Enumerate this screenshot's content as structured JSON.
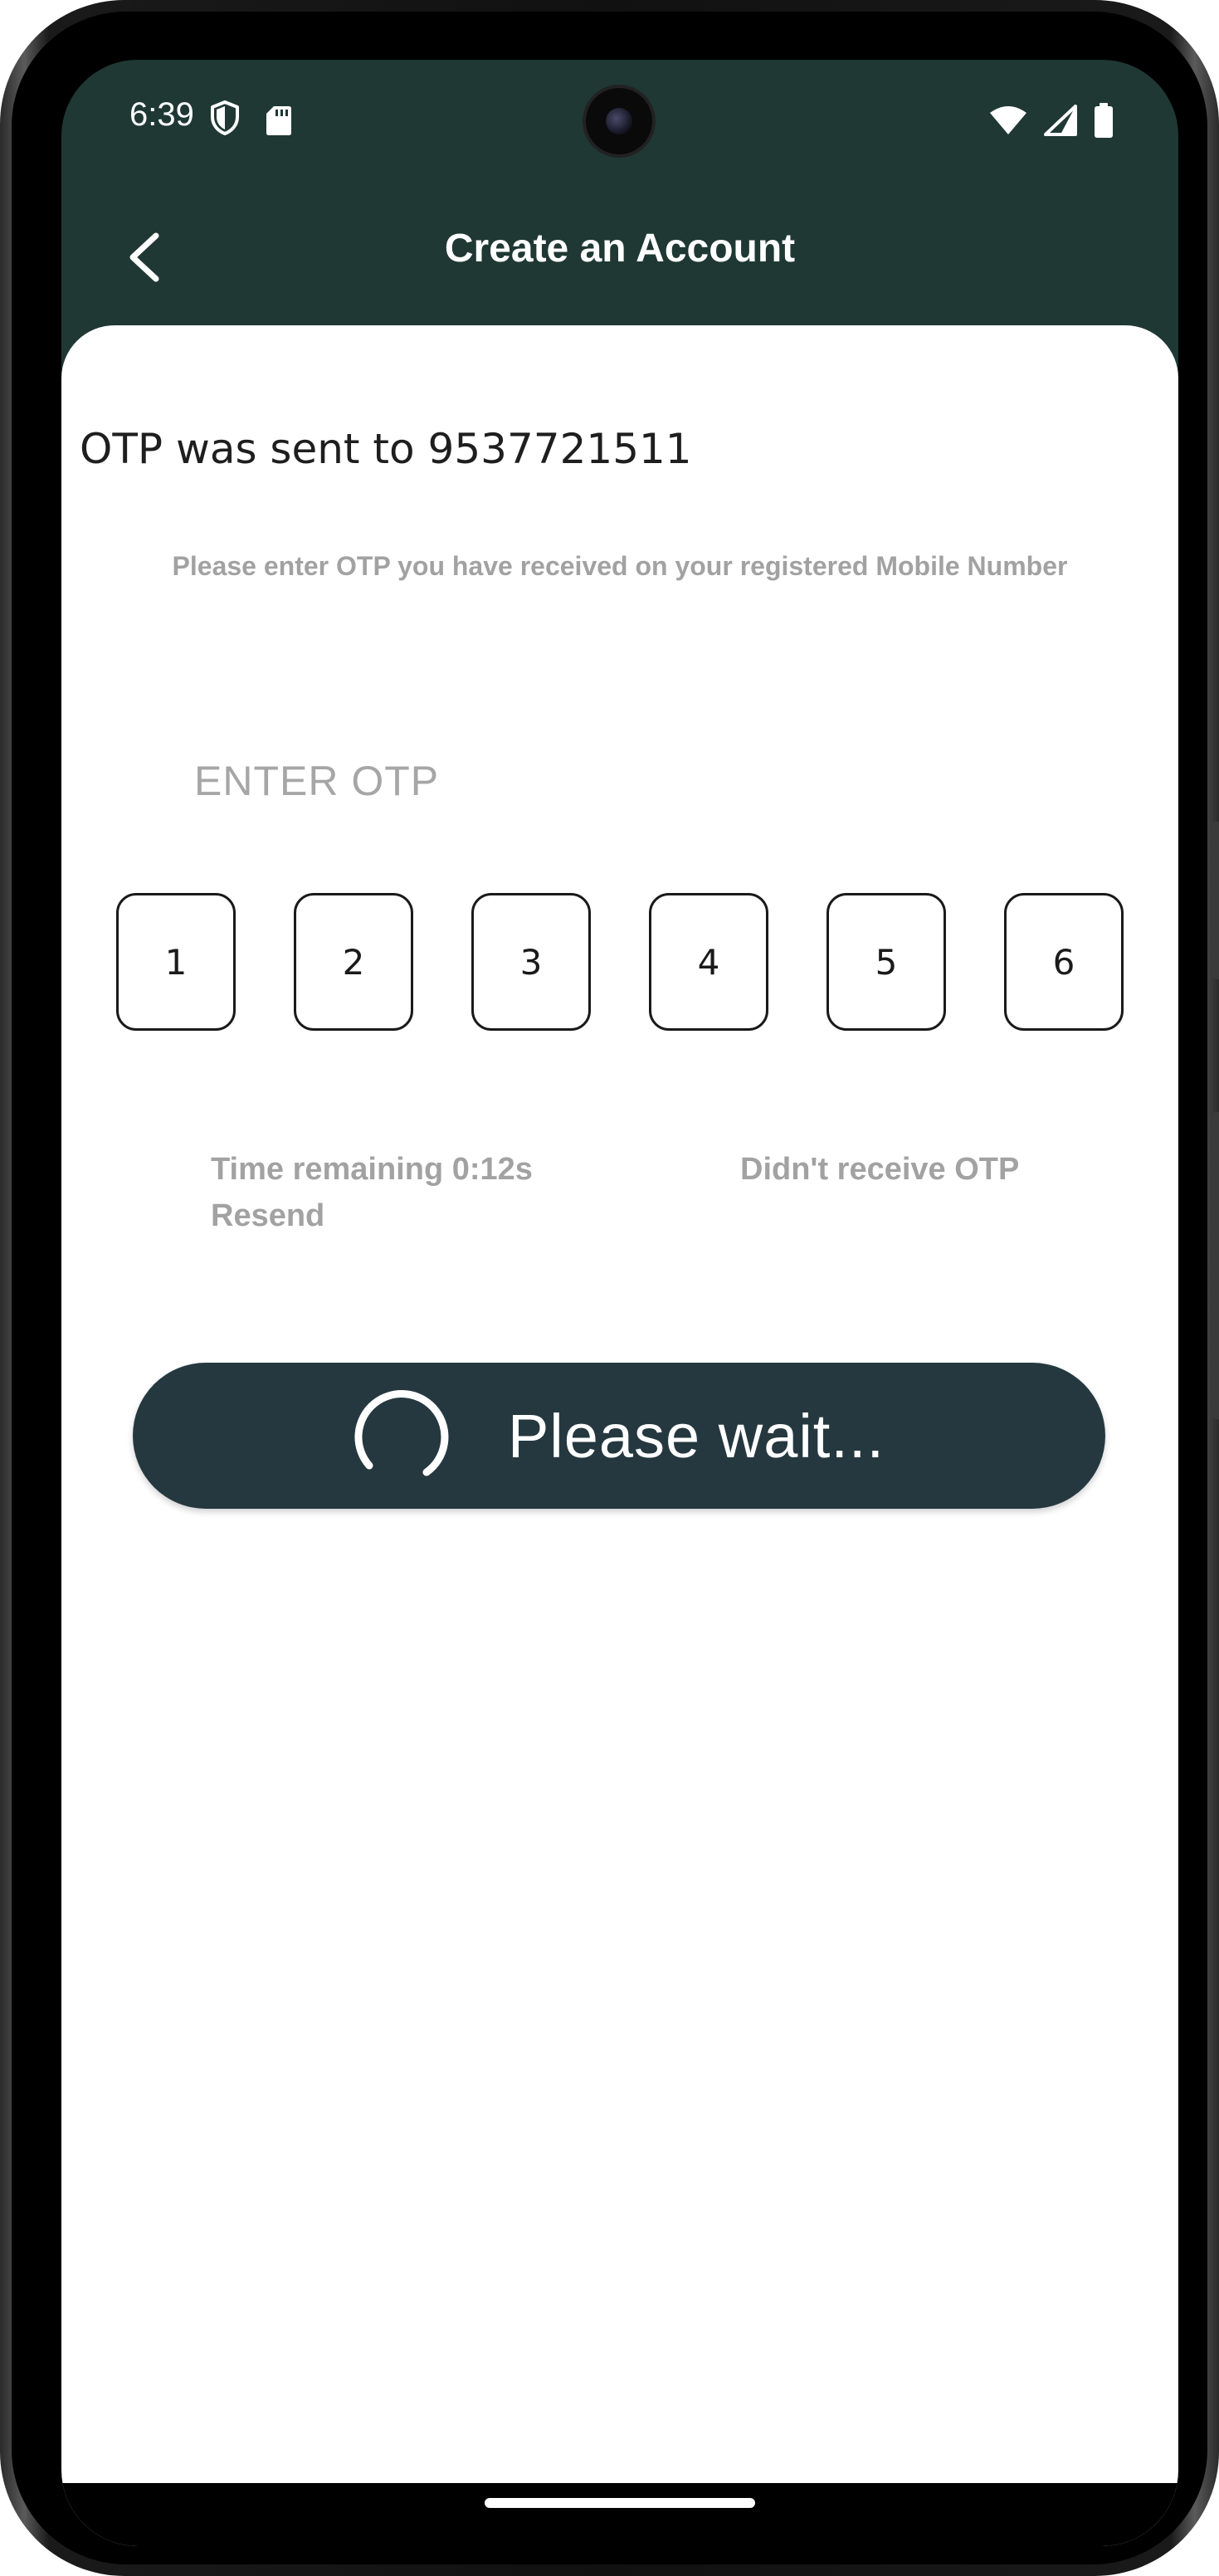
{
  "status_bar": {
    "time": "6:39",
    "icons": [
      "shield-icon",
      "sd-card-icon",
      "wifi-icon",
      "signal-icon",
      "battery-icon"
    ]
  },
  "app_bar": {
    "title": "Create an Account",
    "back_icon": "chevron-left-icon",
    "background_color": "#1f3833"
  },
  "otp_screen": {
    "sent_message": "OTP was sent to 9537721511",
    "instruction": "Please enter OTP you have received on your registered Mobile Number",
    "enter_otp_label": "ENTER OTP",
    "digits": [
      "1",
      "2",
      "3",
      "4",
      "5",
      "6"
    ],
    "timer_text": "Time remaining 0:12s",
    "resend_label": "Resend",
    "didnt_receive_label": "Didn't receive OTP"
  },
  "submit_button": {
    "label": "Please wait...",
    "spinner_icon": "loading-spinner-icon",
    "background_color": "#253840"
  }
}
